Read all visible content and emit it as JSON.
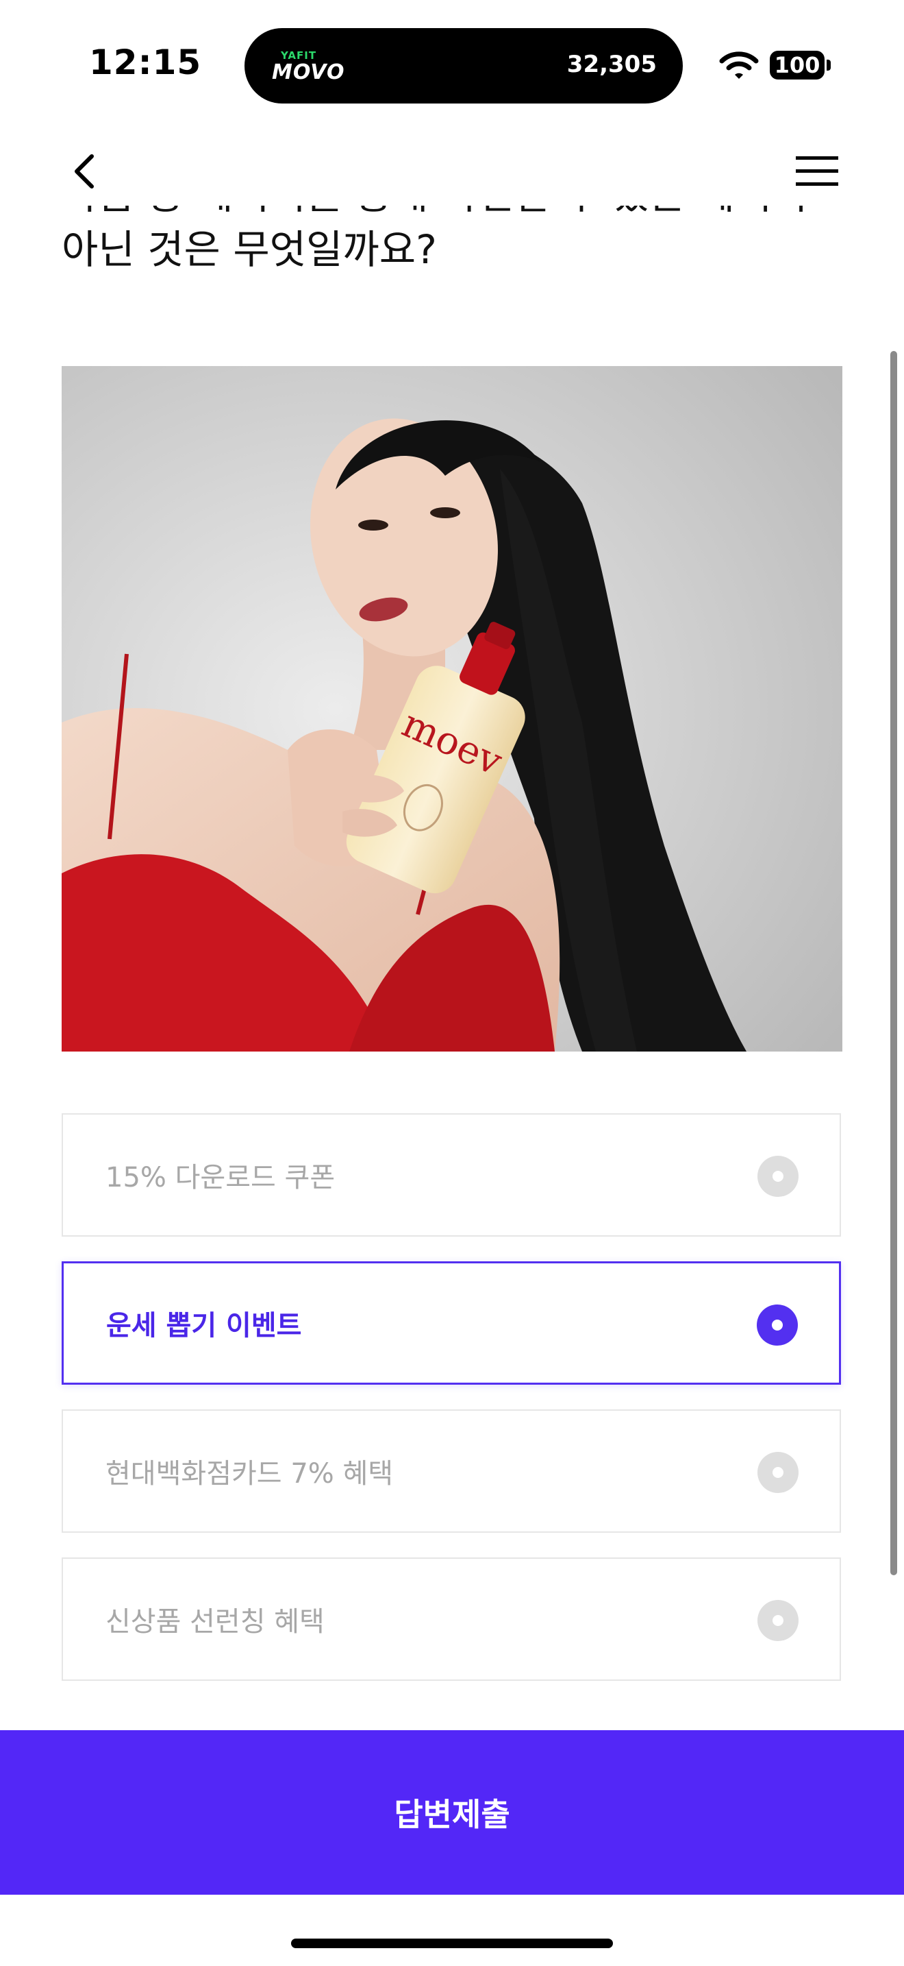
{
  "status_bar": {
    "time": "12:15",
    "battery": "100"
  },
  "live_activity": {
    "brand_top": "YAFIT",
    "brand": "MOVO",
    "count": "32,305"
  },
  "nav": {
    "back_icon": "chevron-left-icon",
    "menu_icon": "hamburger-menu-icon"
  },
  "question": {
    "text": "다음 중 페이지를 통해 확인할 수 있는 혜택이 아닌 것은 무엇일까요?"
  },
  "image": {
    "brand_text": "moev"
  },
  "options": [
    {
      "label": "15% 다운로드 쿠폰",
      "selected": false
    },
    {
      "label": "운세 뽑기 이벤트",
      "selected": true
    },
    {
      "label": "현대백화점카드 7% 혜택",
      "selected": false
    },
    {
      "label": "신상품 선런칭 혜택",
      "selected": false
    }
  ],
  "submit": {
    "label": "답변제출"
  },
  "colors": {
    "accent": "#5327f7",
    "selected_text": "#4a26e8",
    "unselected_text": "#a7a7a7",
    "border": "#e6e6e6"
  }
}
